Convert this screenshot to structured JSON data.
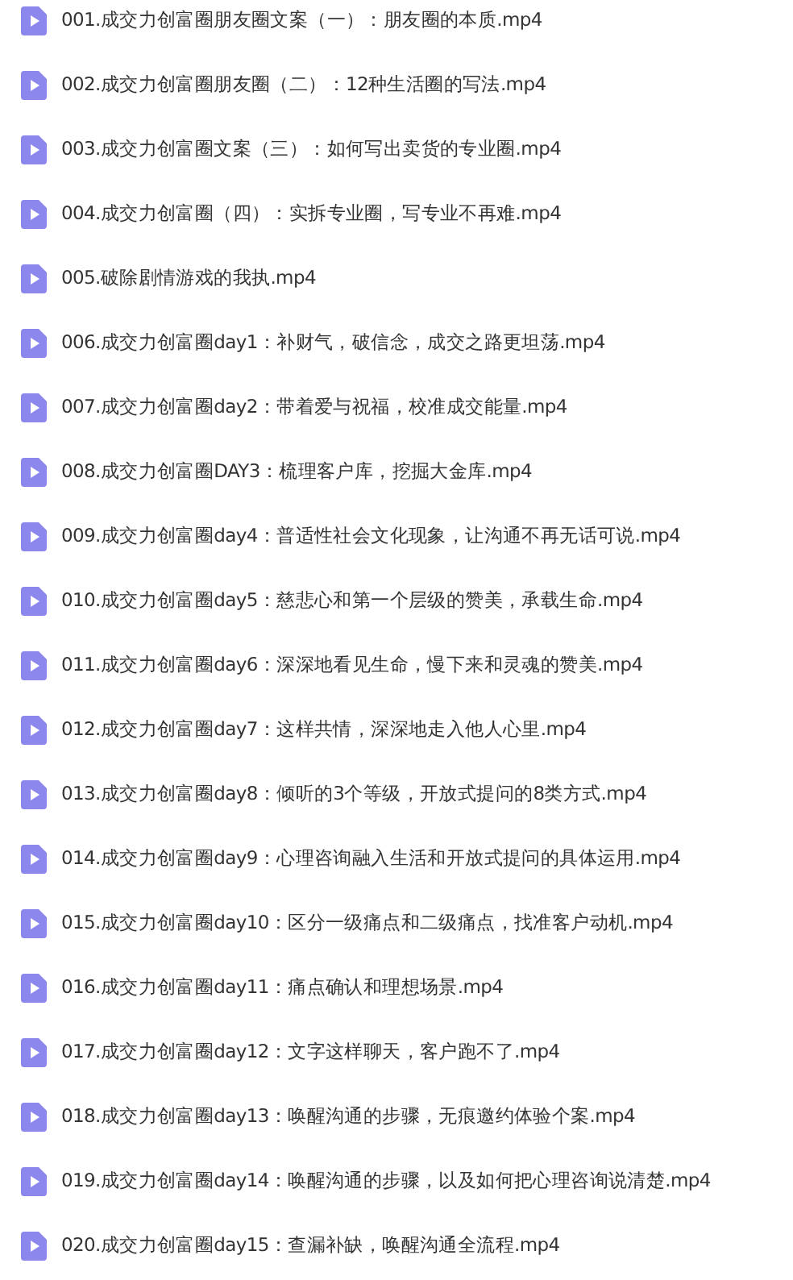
{
  "files": [
    {
      "name": "001.成交力创富圈朋友圈文案（一）：朋友圈的本质.mp4"
    },
    {
      "name": "002.成交力创富圈朋友圈（二）：12种生活圈的写法.mp4"
    },
    {
      "name": "003.成交力创富圈文案（三）：如何写出卖货的专业圈.mp4"
    },
    {
      "name": "004.成交力创富圈（四）：实拆专业圈，写专业不再难.mp4"
    },
    {
      "name": "005.破除剧情游戏的我执.mp4"
    },
    {
      "name": "006.成交力创富圈day1：补财气，破信念，成交之路更坦荡.mp4"
    },
    {
      "name": "007.成交力创富圈day2：带着爱与祝福，校准成交能量.mp4"
    },
    {
      "name": "008.成交力创富圈DAY3：梳理客户库，挖掘大金库.mp4"
    },
    {
      "name": "009.成交力创富圈day4：普适性社会文化现象，让沟通不再无话可说.mp4"
    },
    {
      "name": "010.成交力创富圈day5：慈悲心和第一个层级的赞美，承载生命.mp4"
    },
    {
      "name": "011.成交力创富圈day6：深深地看见生命，慢下来和灵魂的赞美.mp4"
    },
    {
      "name": "012.成交力创富圈day7：这样共情，深深地走入他人心里.mp4"
    },
    {
      "name": "013.成交力创富圈day8：倾听的3个等级，开放式提问的8类方式.mp4"
    },
    {
      "name": "014.成交力创富圈day9：心理咨询融入生活和开放式提问的具体运用.mp4"
    },
    {
      "name": "015.成交力创富圈day10：区分一级痛点和二级痛点，找准客户动机.mp4"
    },
    {
      "name": "016.成交力创富圈day11：痛点确认和理想场景.mp4"
    },
    {
      "name": "017.成交力创富圈day12：文字这样聊天，客户跑不了.mp4"
    },
    {
      "name": "018.成交力创富圈day13：唤醒沟通的步骤，无痕邀约体验个案.mp4"
    },
    {
      "name": "019.成交力创富圈day14：唤醒沟通的步骤，以及如何把心理咨询说清楚.mp4"
    },
    {
      "name": "020.成交力创富圈day15：查漏补缺，唤醒沟通全流程.mp4"
    }
  ]
}
